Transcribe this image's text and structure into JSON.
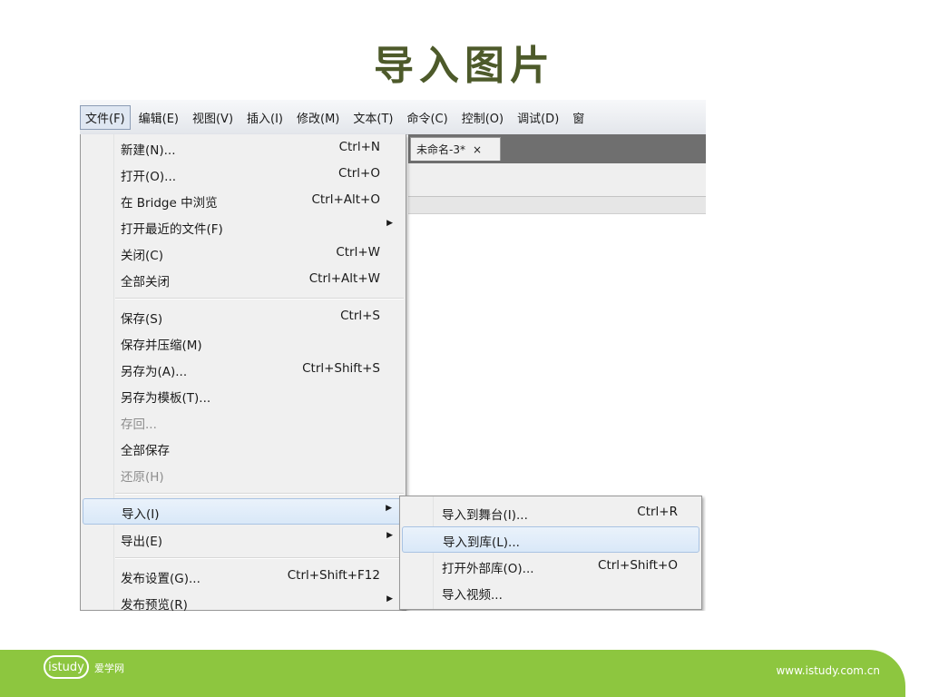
{
  "slide": {
    "title": "导入图片"
  },
  "menubar": {
    "items": [
      "文件(F)",
      "编辑(E)",
      "视图(V)",
      "插入(I)",
      "修改(M)",
      "文本(T)",
      "命令(C)",
      "控制(O)",
      "调试(D)",
      "窗"
    ]
  },
  "document": {
    "tab_label": "未命名-3*",
    "tab_close": "×"
  },
  "file_menu": {
    "items": [
      {
        "label": "新建(N)...",
        "shortcut": "Ctrl+N"
      },
      {
        "label": "打开(O)...",
        "shortcut": "Ctrl+O"
      },
      {
        "label": "在 Bridge 中浏览",
        "shortcut": "Ctrl+Alt+O"
      },
      {
        "label": "打开最近的文件(F)",
        "shortcut": ""
      },
      {
        "label": "关闭(C)",
        "shortcut": "Ctrl+W"
      },
      {
        "label": "全部关闭",
        "shortcut": "Ctrl+Alt+W"
      },
      {
        "label": "保存(S)",
        "shortcut": "Ctrl+S"
      },
      {
        "label": "保存并压缩(M)",
        "shortcut": ""
      },
      {
        "label": "另存为(A)...",
        "shortcut": "Ctrl+Shift+S"
      },
      {
        "label": "另存为模板(T)...",
        "shortcut": ""
      },
      {
        "label": "存回...",
        "shortcut": ""
      },
      {
        "label": "全部保存",
        "shortcut": ""
      },
      {
        "label": "还原(H)",
        "shortcut": ""
      },
      {
        "label": "导入(I)",
        "shortcut": ""
      },
      {
        "label": "导出(E)",
        "shortcut": ""
      },
      {
        "label": "发布设置(G)...",
        "shortcut": "Ctrl+Shift+F12"
      },
      {
        "label": "发布预览(R)",
        "shortcut": ""
      }
    ],
    "arrow_glyph": "▶"
  },
  "import_submenu": {
    "items": [
      {
        "label": "导入到舞台(I)...",
        "shortcut": "Ctrl+R"
      },
      {
        "label": "导入到库(L)...",
        "shortcut": ""
      },
      {
        "label": "打开外部库(O)...",
        "shortcut": "Ctrl+Shift+O"
      },
      {
        "label": "导入视频...",
        "shortcut": ""
      }
    ]
  },
  "footer": {
    "logo_text": "istudy",
    "logo_cn": "爱学网",
    "url": "www.istudy.com.cn"
  }
}
